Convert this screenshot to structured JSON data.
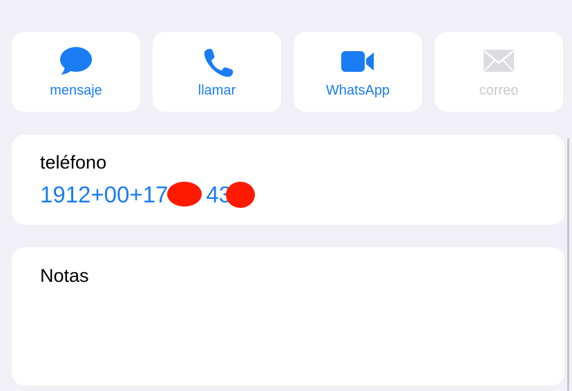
{
  "actions": [
    {
      "label": "mensaje",
      "icon": "message-bubble-icon",
      "enabled": true
    },
    {
      "label": "llamar",
      "icon": "phone-icon",
      "enabled": true
    },
    {
      "label": "WhatsApp",
      "icon": "video-camera-icon",
      "enabled": true
    },
    {
      "label": "correo",
      "icon": "envelope-icon",
      "enabled": false
    }
  ],
  "phone": {
    "label": "teléfono",
    "value": "1912+00+17  47  433"
  },
  "notes": {
    "label": "Notas"
  },
  "colors": {
    "background": "#f0f0f6",
    "card": "#ffffff",
    "accent": "#1a7cf2",
    "disabled": "#c9c9cf",
    "redaction": "#ff1a00"
  }
}
